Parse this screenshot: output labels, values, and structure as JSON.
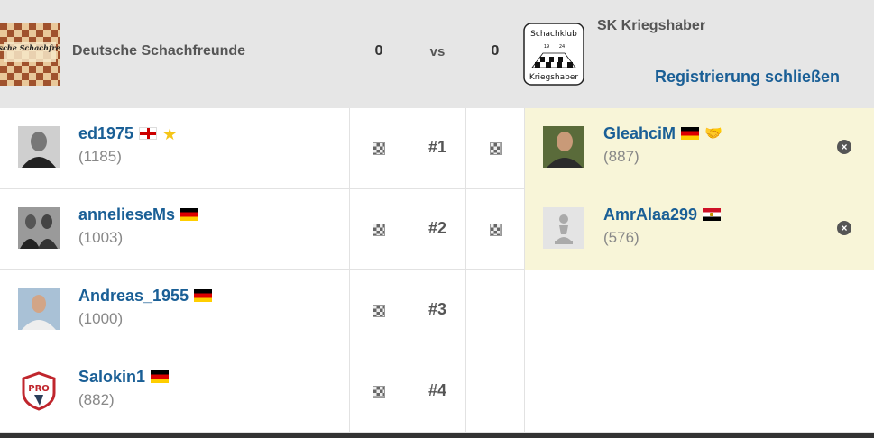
{
  "header": {
    "home_name": "Deutsche Schachfreunde",
    "home_logo_text": "Deutsche Schachfreunde",
    "home_score": "0",
    "vs": "vs",
    "away_score": "0",
    "away_name": "SK Kriegshaber",
    "away_logo_top": "Schachklub",
    "away_logo_year_left": "19",
    "away_logo_year_right": "24",
    "away_logo_bottom": "Kriegshaber",
    "close_registration": "Registrierung schließen"
  },
  "boards": [
    {
      "number": "#1",
      "home": {
        "name": "ed1975",
        "rating": "(1185)",
        "flag": "en",
        "badge": "star",
        "avatar": "bw-portrait"
      },
      "away": {
        "name": "GleahciM",
        "rating": "(887)",
        "flag": "de",
        "badge": "handshake",
        "avatar": "color-portrait"
      }
    },
    {
      "number": "#2",
      "home": {
        "name": "annelieseMs",
        "rating": "(1003)",
        "flag": "de",
        "badge": "",
        "avatar": "bw-group"
      },
      "away": {
        "name": "AmrAlaa299",
        "rating": "(576)",
        "flag": "eg",
        "badge": "",
        "avatar": "pawn-default"
      }
    },
    {
      "number": "#3",
      "home": {
        "name": "Andreas_1955",
        "rating": "(1000)",
        "flag": "de",
        "badge": "",
        "avatar": "color-portrait"
      },
      "away": null
    },
    {
      "number": "#4",
      "home": {
        "name": "Salokin1",
        "rating": "(882)",
        "flag": "de",
        "badge": "",
        "avatar": "pro-shield"
      },
      "away": null
    }
  ],
  "colors": {
    "header_bg": "#e6e6e6",
    "link": "#1a5f96",
    "away_filled_bg": "#f8f5d8",
    "rating": "#888888"
  },
  "icons": {
    "board": "chessboard-icon",
    "remove": "remove-circle-icon",
    "star": "star-icon",
    "handshake": "handshake-icon"
  }
}
